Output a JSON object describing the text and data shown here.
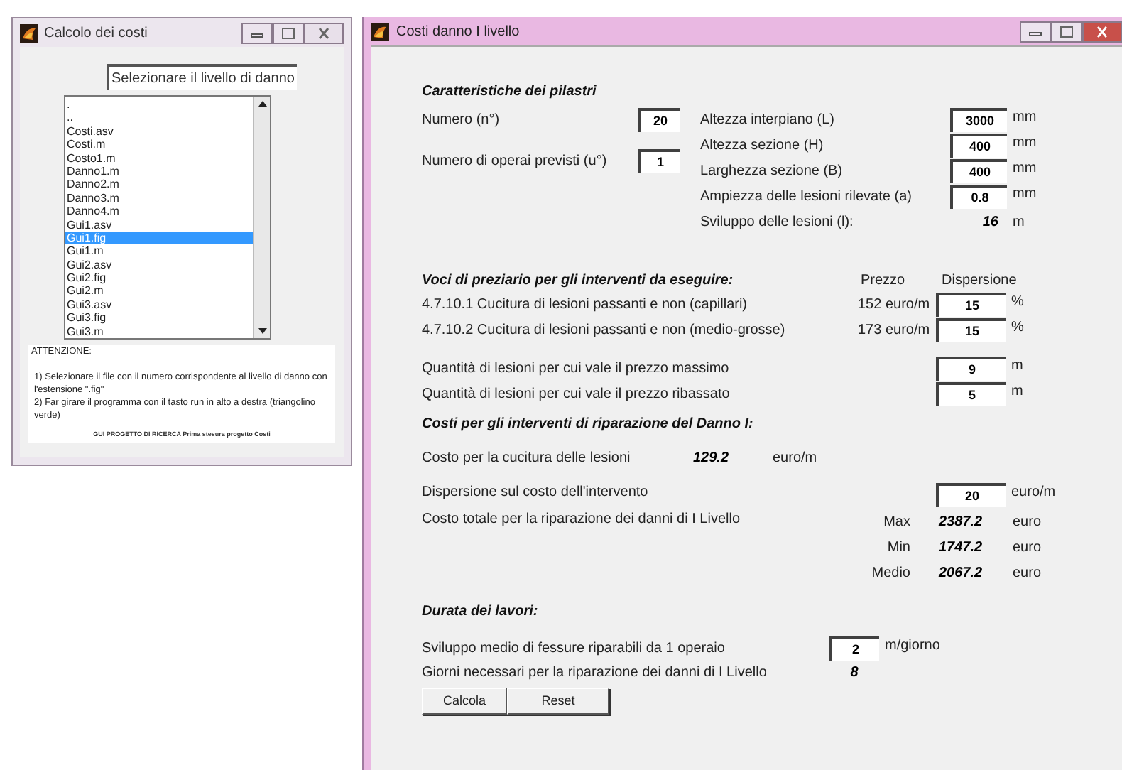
{
  "file_window": {
    "title": "Calcolo dei costi",
    "heading": "Selezionare il livello di danno",
    "files": [
      {
        "name": ".",
        "selected": false
      },
      {
        "name": "..",
        "selected": false
      },
      {
        "name": "Costi.asv",
        "selected": false
      },
      {
        "name": "Costi.m",
        "selected": false
      },
      {
        "name": "Costo1.m",
        "selected": false
      },
      {
        "name": "Danno1.m",
        "selected": false
      },
      {
        "name": "Danno2.m",
        "selected": false
      },
      {
        "name": "Danno3.m",
        "selected": false
      },
      {
        "name": "Danno4.m",
        "selected": false
      },
      {
        "name": "Gui1.asv",
        "selected": false
      },
      {
        "name": "Gui1.fig",
        "selected": true
      },
      {
        "name": "Gui1.m",
        "selected": false
      },
      {
        "name": "Gui2.asv",
        "selected": false
      },
      {
        "name": "Gui2.fig",
        "selected": false
      },
      {
        "name": "Gui2.m",
        "selected": false
      },
      {
        "name": "Gui3.asv",
        "selected": false
      },
      {
        "name": "Gui3.fig",
        "selected": false
      },
      {
        "name": "Gui3.m",
        "selected": false
      }
    ],
    "notes": {
      "title": "ATTENZIONE:",
      "lines": [
        "1) Selezionare il file con il numero corrispondente al livello di danno con l'estensione \".fig\"",
        "2) Far girare il programma con il tasto run in alto a destra (triangolino verde)"
      ]
    },
    "footer": "GUI PROGETTO DI RICERCA Prima stesura progetto Costi"
  },
  "cost_window": {
    "title": "Costi danno I livello",
    "pillars": {
      "heading": "Caratteristiche dei pilastri",
      "left_fields": [
        {
          "label": "Numero (n°)",
          "value": "20"
        },
        {
          "label": "Numero di operai previsti (u°)",
          "value": "1"
        }
      ],
      "right_fields": [
        {
          "label": "Altezza interpiano (L)",
          "value": "3000",
          "unit": "mm"
        },
        {
          "label": "Altezza sezione (H)",
          "value": "400",
          "unit": "mm"
        },
        {
          "label": "Larghezza sezione (B)",
          "value": "400",
          "unit": "mm"
        },
        {
          "label": "Ampiezza delle lesioni rilevate (a)",
          "value": "0.8",
          "unit": "mm"
        }
      ],
      "result": {
        "label": "Sviluppo delle lesioni (l):",
        "value": "16",
        "unit": "m"
      }
    },
    "price_list": {
      "heading": "Voci di preziario per gli interventi da eseguire:",
      "price_header": "Prezzo",
      "dispersion_header": "Dispersione",
      "items": [
        {
          "label": "4.7.10.1 Cucitura di lesioni passanti e non (capillari)",
          "price": "152 euro/m",
          "dispersion": "15",
          "unit": "%"
        },
        {
          "label": "4.7.10.2 Cucitura di lesioni passanti e non (medio-grosse)",
          "price": "173 euro/m",
          "dispersion": "15",
          "unit": "%"
        }
      ]
    },
    "quantities": [
      {
        "label": "Quantità di lesioni per cui vale il prezzo massimo",
        "value": "9",
        "unit": "m"
      },
      {
        "label": "Quantità di lesioni per cui vale il prezzo ribassato",
        "value": "5",
        "unit": "m"
      }
    ],
    "costs": {
      "heading": "Costi per gli interventi di riparazione del Danno I:",
      "sewing": {
        "label": "Costo per la cucitura delle lesioni",
        "value": "129.2",
        "unit": "euro/m"
      },
      "dispersion": {
        "label": "Dispersione sul costo dell'intervento",
        "value": "20",
        "unit": "euro/m"
      },
      "total": {
        "label": "Costo totale per la riparazione dei danni di I Livello",
        "rows": [
          {
            "label": "Max",
            "value": "2387.2",
            "unit": "euro"
          },
          {
            "label": "Min",
            "value": "1747.2",
            "unit": "euro"
          },
          {
            "label": "Medio",
            "value": "2067.2",
            "unit": "euro"
          }
        ]
      }
    },
    "duration": {
      "heading": "Durata dei lavori:",
      "rate": {
        "label": "Sviluppo medio di fessure riparabili da 1 operaio",
        "value": "2",
        "unit": "m/giorno"
      },
      "days": {
        "label": "Giorni necessari per la riparazione dei danni di I Livello",
        "value": "8"
      }
    },
    "buttons": [
      "Calcola",
      "Reset"
    ]
  }
}
